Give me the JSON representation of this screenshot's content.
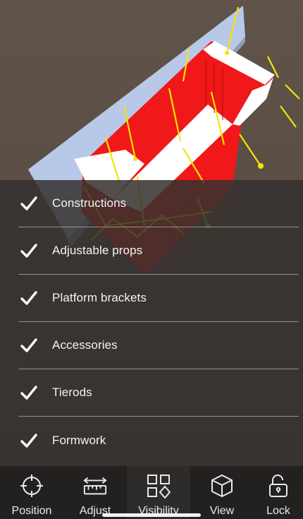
{
  "visibility": {
    "items": [
      {
        "label": "Constructions",
        "checked": true
      },
      {
        "label": "Adjustable props",
        "checked": true
      },
      {
        "label": "Platform brackets",
        "checked": true
      },
      {
        "label": "Accessories",
        "checked": true
      },
      {
        "label": "Tierods",
        "checked": true
      },
      {
        "label": "Formwork",
        "checked": true
      }
    ]
  },
  "tabbar": {
    "active": "Visibility",
    "tabs": [
      {
        "label": "Position",
        "icon": "crosshair-icon"
      },
      {
        "label": "Adjust",
        "icon": "ruler-icon"
      },
      {
        "label": "Visibility",
        "icon": "shapes-grid-icon"
      },
      {
        "label": "View",
        "icon": "cube-icon"
      },
      {
        "label": "Lock",
        "icon": "unlock-icon"
      }
    ]
  },
  "colors": {
    "panel": "#34312e",
    "wall": "#b7c7e6",
    "formwork": "#ff1a1a",
    "props": "#f2e400",
    "tabbar": "#232120"
  }
}
